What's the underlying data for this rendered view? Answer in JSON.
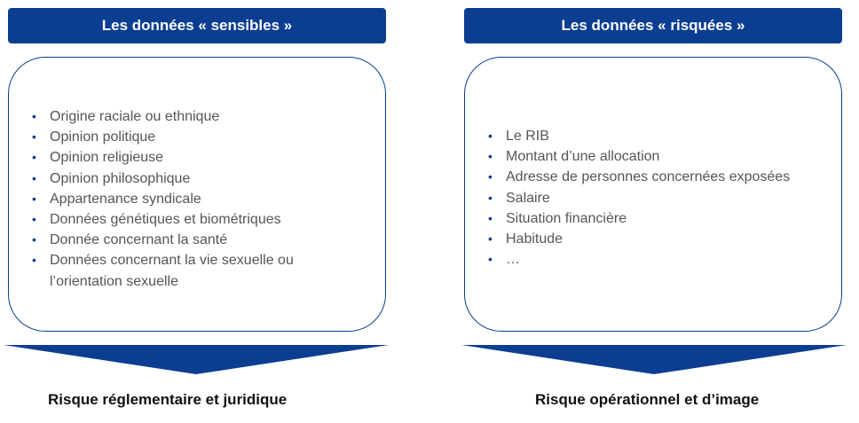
{
  "left": {
    "header": "Les données « sensibles »",
    "items": [
      "Origine raciale ou ethnique",
      "Opinion politique",
      "Opinion religieuse",
      "Opinion philosophique",
      "Appartenance syndicale",
      "Données génétiques et biométriques",
      "Donnée concernant la santé",
      "Données concernant la vie sexuelle ou l’orientation sexuelle"
    ],
    "footer": "Risque réglementaire et juridique"
  },
  "right": {
    "header": "Les données « risquées »",
    "items": [
      "Le RIB",
      "Montant d’une allocation",
      "Adresse de personnes concernées exposées",
      "Salaire",
      "Situation financière",
      "Habitude",
      "…"
    ],
    "footer": "Risque opérationnel et d’image"
  },
  "colors": {
    "accent": "#0b3d91",
    "text": "#555555",
    "footer": "#111111"
  }
}
